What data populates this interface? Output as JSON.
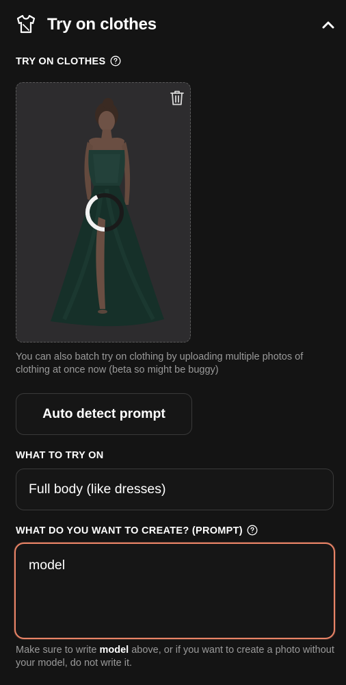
{
  "header": {
    "icon": "shirt-icon",
    "title": "Try on clothes",
    "collapse_icon": "chevron-up-icon"
  },
  "upload": {
    "label": "TRY ON CLOTHES",
    "help_icon": "question-circle-icon",
    "delete_icon": "trash-icon",
    "loading_icon": "spinner-icon",
    "note": "You can also batch try on clothing by uploading multiple photos of clothing at once now (beta so might be buggy)"
  },
  "auto_detect": {
    "label": "Auto detect prompt"
  },
  "what_to_try": {
    "label": "WHAT TO TRY ON",
    "selected": "Full body (like dresses)"
  },
  "prompt": {
    "label": "WHAT DO YOU WANT TO CREATE? (PROMPT)",
    "help_icon": "question-circle-icon",
    "value": "model",
    "accent_color": "#e98467",
    "hint_before": "Make sure to write ",
    "hint_keyword": "model",
    "hint_after": " above, or if you want to create a photo without your model, do not write it."
  },
  "colors": {
    "background": "#141414",
    "field_border": "#3a3a3a",
    "muted_text": "#9a9a9a"
  }
}
